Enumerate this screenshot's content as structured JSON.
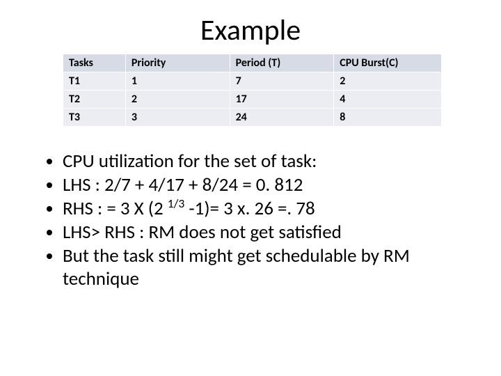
{
  "title": "Example",
  "table": {
    "headers": [
      "Tasks",
      "Priority",
      "Period (T)",
      "CPU Burst(C)"
    ],
    "rows": [
      [
        "T1",
        "1",
        "7",
        "2"
      ],
      [
        "T2",
        "2",
        "17",
        "4"
      ],
      [
        "T3",
        "3",
        "24",
        "8"
      ]
    ]
  },
  "bullets": {
    "b1": "CPU utilization for the set of task:",
    "b2": "LHS : 2/7 + 4/17 + 8/24 = 0. 812",
    "b3_a": "RHS : = 3 X (2 ",
    "b3_sup": "1/3",
    "b3_b": " -1)= 3 x. 26 =. 78",
    "b4": "LHS> RHS   : RM does not get satisfied",
    "b5": "But the task still might get schedulable by RM technique"
  },
  "chart_data": {
    "type": "table",
    "columns": [
      "Tasks",
      "Priority",
      "Period (T)",
      "CPU Burst(C)"
    ],
    "rows": [
      {
        "Tasks": "T1",
        "Priority": 1,
        "Period (T)": 7,
        "CPU Burst(C)": 2
      },
      {
        "Tasks": "T2",
        "Priority": 2,
        "Period (T)": 17,
        "CPU Burst(C)": 4
      },
      {
        "Tasks": "T3",
        "Priority": 3,
        "Period (T)": 24,
        "CPU Burst(C)": 8
      }
    ],
    "title": "Example"
  }
}
